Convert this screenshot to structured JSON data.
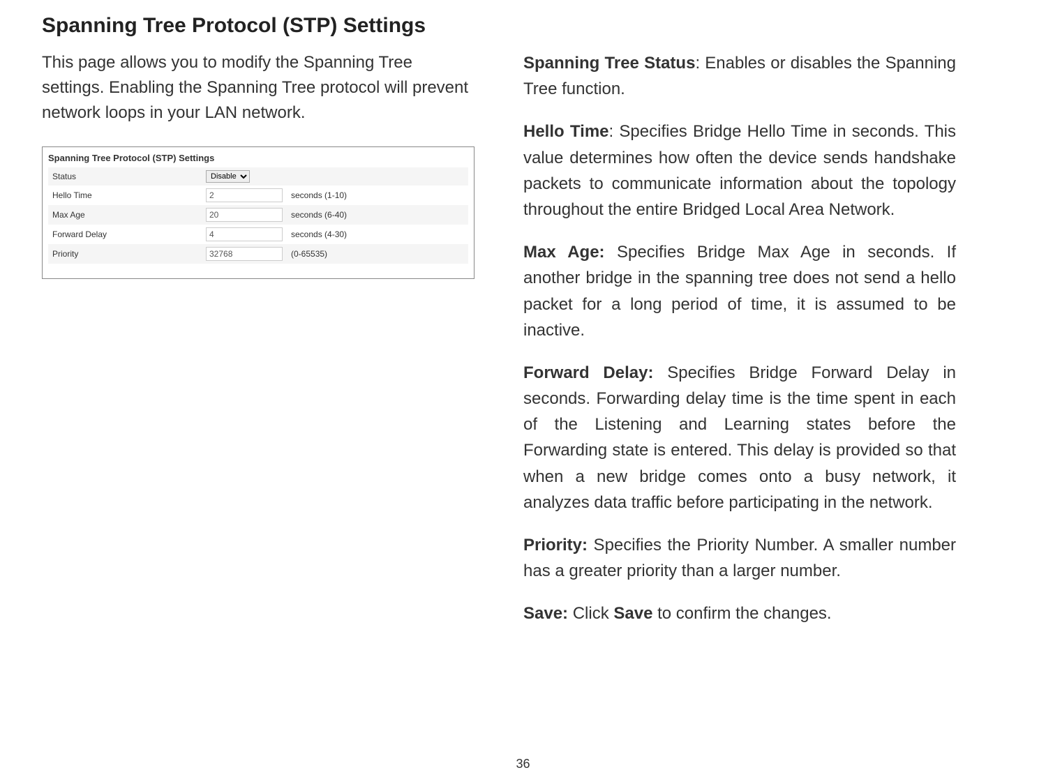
{
  "title": "Spanning Tree Protocol (STP) Settings",
  "intro": "This page allows you to modify the Spanning Tree settings. Enabling the Spanning Tree protocol will prevent network loops in your LAN network.",
  "screenshot": {
    "title": "Spanning Tree Protocol (STP) Settings",
    "rows": [
      {
        "label": "Status",
        "control": "select",
        "value": "Disable",
        "range": ""
      },
      {
        "label": "Hello Time",
        "control": "input",
        "value": "2",
        "range": "seconds (1-10)"
      },
      {
        "label": "Max Age",
        "control": "input",
        "value": "20",
        "range": "seconds (6-40)"
      },
      {
        "label": "Forward Delay",
        "control": "input",
        "value": "4",
        "range": "seconds (4-30)"
      },
      {
        "label": "Priority",
        "control": "input",
        "value": "32768",
        "range": "(0-65535)"
      }
    ]
  },
  "definitions": {
    "status_label": "Spanning Tree Status",
    "status_text": ": Enables or disables the Spanning Tree function.",
    "hello_label": "Hello Time",
    "hello_text": ": Specifies Bridge Hello Time in seconds. This value determines how often the device sends handshake packets to communicate information about the topology throughout the entire Bridged Local Area Network.",
    "maxage_label": "Max Age:",
    "maxage_text": " Specifies Bridge Max Age in seconds. If another bridge in the spanning tree does not send a hello packet for a long period of time, it is assumed to be inactive.",
    "forward_label": "Forward Delay:",
    "forward_text": " Specifies Bridge Forward Delay in seconds. Forwarding delay time is the time spent in each of the Listening and Learning states before the Forwarding state is entered. This delay is provided so that when a new bridge comes onto a busy network, it analyzes data traffic before participating in the network.",
    "priority_label": "Priority:",
    "priority_text": " Specifies the Priority Number. A smaller number has a greater priority than a larger number.",
    "save_label": "Save:",
    "save_mid": " Click ",
    "save_bold": "Save",
    "save_end": " to confirm the changes."
  },
  "page_number": "36"
}
